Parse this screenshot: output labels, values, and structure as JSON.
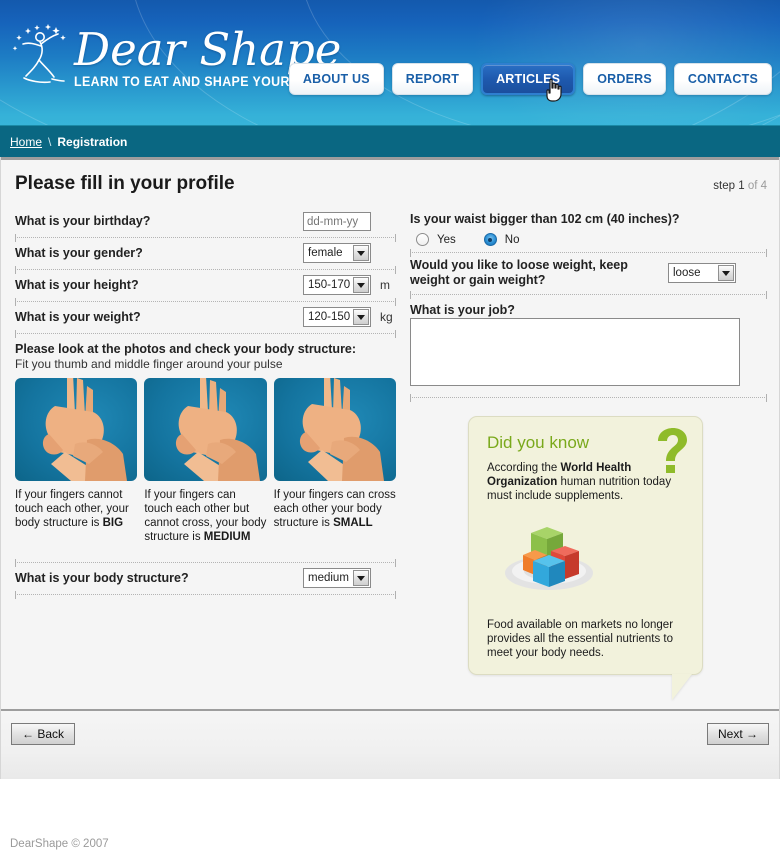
{
  "header": {
    "logo_title": "Dear Shape",
    "logo_tagline": "LEARN TO EAT AND SHAPE YOUR SHAPE!",
    "nav": [
      {
        "label": "ABOUT US",
        "active": false
      },
      {
        "label": "REPORT",
        "active": false
      },
      {
        "label": "ARTICLES",
        "active": true
      },
      {
        "label": "ORDERS",
        "active": false
      },
      {
        "label": "CONTACTS",
        "active": false
      }
    ]
  },
  "breadcrumb": {
    "home": "Home",
    "separator": "\\",
    "current": "Registration"
  },
  "page": {
    "title": "Please fill in your profile",
    "step_label": "step 1",
    "step_total": "of 4"
  },
  "left_column": {
    "birthday": {
      "label": "What is your birthday?",
      "placeholder": "dd-mm-yy",
      "value": ""
    },
    "gender": {
      "label": "What is your gender?",
      "value": "female"
    },
    "height": {
      "label": "What is your height?",
      "value": "150-170",
      "unit": "m"
    },
    "weight": {
      "label": "What is your weight?",
      "value": "120-150",
      "unit": "kg"
    },
    "photos_heading": "Please look at the photos and check your body structure:",
    "photos_note": "Fit you  thumb  and middle finger around your pulse",
    "captions": [
      {
        "text": "If your fingers cannot touch each other, your body structure is ",
        "emphasis": "BIG"
      },
      {
        "text": "If your fingers can touch each other but cannot cross, your body structure is ",
        "emphasis": "MEDIUM"
      },
      {
        "text": "If your fingers can cross each other  your body structure is ",
        "emphasis": "SMALL"
      }
    ],
    "body_structure": {
      "label": "What is your body structure?",
      "value": "medium"
    }
  },
  "right_column": {
    "waist": {
      "label": "Is your waist bigger than 102 cm (40  inches)?",
      "options": [
        {
          "label": "Yes",
          "selected": false
        },
        {
          "label": "No",
          "selected": true
        }
      ]
    },
    "goal": {
      "label": "Would you like to loose weight, keep weight or gain weight?",
      "value": "loose"
    },
    "job": {
      "label": "What is your job?",
      "value": ""
    }
  },
  "callout": {
    "title": "Did you know",
    "icon": "question-mark-icon",
    "body_top_part1": "According the ",
    "body_top_bold": "World Health Organization",
    "body_top_part2": " human nutrition today must include supplements.",
    "body_bottom": "Food available on markets no longer provides all the essential nutrients to meet your body needs."
  },
  "footer": {
    "back_label": "← Back",
    "next_label": "Next →",
    "copyright": "DearShape © 2007"
  },
  "colors": {
    "header_top": "#1459ad",
    "header_bottom": "#37b4d9",
    "breadcrumb_bg": "#0a6782",
    "accent_green": "#7aa91c",
    "callout_bg": "#f2f2dc",
    "content_bg": "#f5f5f5",
    "active_nav": "#1e59ae"
  }
}
